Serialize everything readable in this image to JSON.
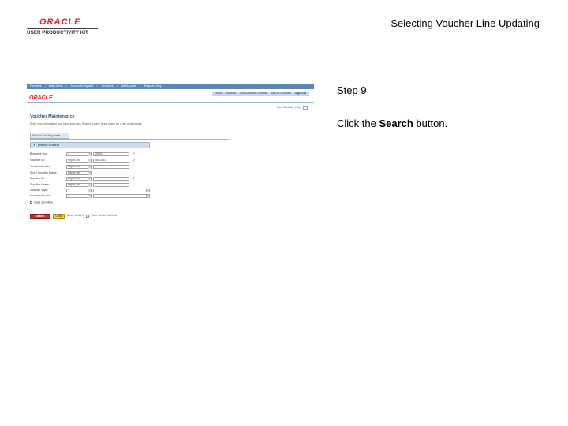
{
  "header": {
    "logo_top": "ORACLE",
    "logo_bottom": "USER PRODUCTIVITY KIT",
    "title": "Selecting Voucher Line Updating"
  },
  "instructions": {
    "step": "Step 9",
    "text_before": "Click the ",
    "text_bold": "Search",
    "text_after": " button."
  },
  "screenshot": {
    "breadcrumbs": [
      "Favorites",
      "Main Menu",
      "Accounts Payable",
      "Vouchers",
      "Add/Update",
      "Regular Entry"
    ],
    "brand": "ORACLE",
    "top_links": [
      "Home",
      "Worklist",
      "MultiChannel Console",
      "Add to Favorites",
      "Sign out"
    ],
    "page_links": [
      "New Window",
      "Help",
      "Customize Page"
    ],
    "page_title": "Voucher Maintenance",
    "page_desc": "Enter any information you have and click Search. Leave fields blank for a list of all values.",
    "tab_find": "Find an Existing Value",
    "criteria_title": "Search Criteria",
    "fields": [
      {
        "label": "Business Unit:",
        "op": "=",
        "value": "US001",
        "lookup": true
      },
      {
        "label": "Voucher ID:",
        "op": "begins with",
        "value": "00001913",
        "lookup": true
      },
      {
        "label": "Invoice Number:",
        "op": "begins with",
        "value": "",
        "lookup": false
      },
      {
        "label": "Short Supplier Name:",
        "op": "begins with",
        "value": "",
        "lookup": false
      },
      {
        "label": "Supplier ID:",
        "op": "begins with",
        "value": "",
        "lookup": true
      },
      {
        "label": "Supplier Name:",
        "op": "begins with",
        "value": "",
        "lookup": false
      },
      {
        "label": "Voucher Style:",
        "op": "=",
        "value": "",
        "lookup": false
      },
      {
        "label": "Voucher Source:",
        "op": "=",
        "value": "",
        "lookup": false
      }
    ],
    "case_sensitive": "Case Sensitive",
    "search_button": "Search",
    "clear_button": "Clear",
    "basic_search": "Basic Search",
    "save_criteria": "Save Search Criteria"
  }
}
